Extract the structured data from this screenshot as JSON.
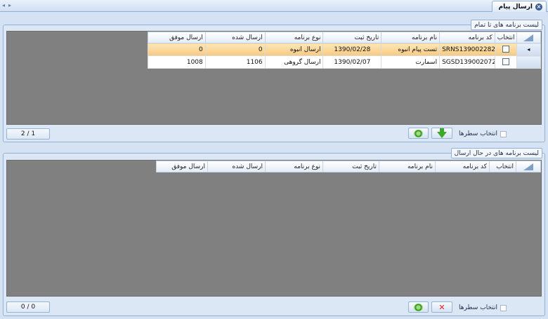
{
  "window": {
    "tab_title": "ارسال پیام",
    "nav_left": "◂",
    "nav_right": "▸"
  },
  "completed_panel": {
    "title": "لیست برنامه های تا تمام",
    "columns": [
      "انتخاب",
      "کد برنامه",
      "نام برنامه",
      "تاریخ ثبت",
      "نوع برنامه",
      "ارسال شده",
      "ارسال موفق"
    ],
    "rows": [
      {
        "code": "SRNS139002282",
        "name": "تست پیام انبوه",
        "date": "1390/02/28",
        "type": "ارسال انبوه",
        "sent": "0",
        "success": "0",
        "selected": true
      },
      {
        "code": "SGSD139002072",
        "name": "اسمارت",
        "date": "1390/02/07",
        "type": "ارسال گروهی",
        "sent": "1106",
        "success": "1008",
        "selected": false
      }
    ],
    "pager": "2 / 1",
    "select_rows_label": "انتخاب سطرها"
  },
  "sending_panel": {
    "title": "لیست برنامه های در حال ارسال",
    "columns": [
      "انتخاب",
      "کد برنامه",
      "نام برنامه",
      "تاریخ ثبت",
      "نوع برنامه",
      "ارسال شده",
      "ارسال موفق"
    ],
    "rows": [],
    "pager": "0 / 0",
    "select_rows_label": "انتخاب سطرها"
  },
  "colors": {
    "background": "#d4e2f3",
    "selected_row": "#f8c981",
    "grid_empty": "#808080"
  },
  "icons": [
    "close-icon",
    "refresh-icon",
    "download-arrow-icon",
    "delete-icon"
  ]
}
